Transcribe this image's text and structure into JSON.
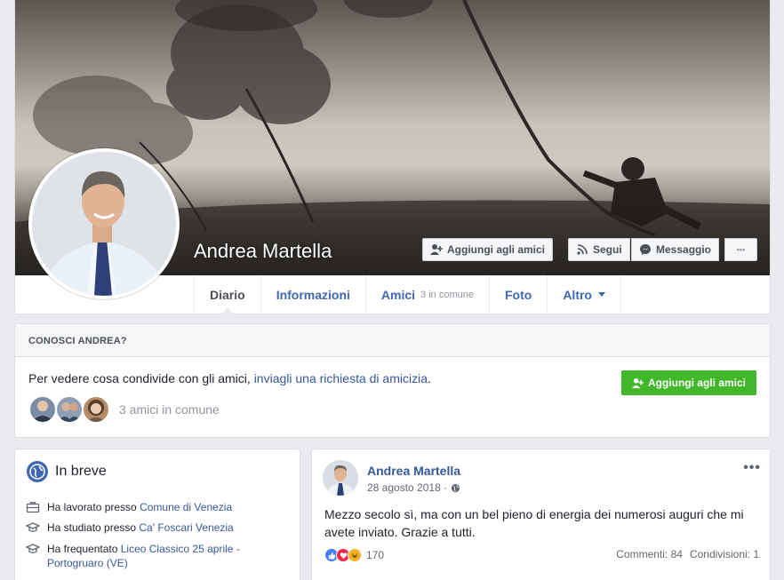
{
  "profile": {
    "name": "Andrea Martella"
  },
  "cover_buttons": {
    "add_friend": "Aggiungi agli amici",
    "follow": "Segui",
    "message": "Messaggio",
    "more": "•••"
  },
  "tabs": [
    {
      "label": "Diario"
    },
    {
      "label": "Informazioni"
    },
    {
      "label": "Amici",
      "sub": "3 in comune"
    },
    {
      "label": "Foto"
    },
    {
      "label": "Altro"
    }
  ],
  "know": {
    "header": "CONOSCI ANDREA?",
    "text_before": "Per vedere cosa condivide con gli amici, ",
    "link": "inviagli una richiesta di amicizia",
    "text_after": ".",
    "button": "Aggiungi agli amici",
    "mutual_text": "3 amici in comune"
  },
  "intro": {
    "title": "In breve",
    "rows": [
      {
        "icon": "briefcase-icon",
        "prefix": "Ha lavorato presso ",
        "link": "Comune di Venezia"
      },
      {
        "icon": "graduation-cap-icon",
        "prefix": "Ha studiato presso ",
        "link": "Ca' Foscari Venezia"
      },
      {
        "icon": "graduation-cap-icon",
        "prefix": "Ha frequentato ",
        "link": "Liceo Classico 25 aprile - Portogruaro (VE)"
      }
    ]
  },
  "post": {
    "author": "Andrea Martella",
    "date": "28 agosto 2018 ·",
    "more": "•••",
    "text": "Mezzo secolo sì, ma con un bel pieno di energia dei numerosi auguri che mi avete inviato. Grazie a tutti.",
    "reaction_count": "170",
    "comments": "Commenti: 84",
    "shares": "Condivisioni: 1"
  },
  "colors": {
    "link": "#365899",
    "brand": "#4267b2",
    "green": "#42b72a"
  }
}
